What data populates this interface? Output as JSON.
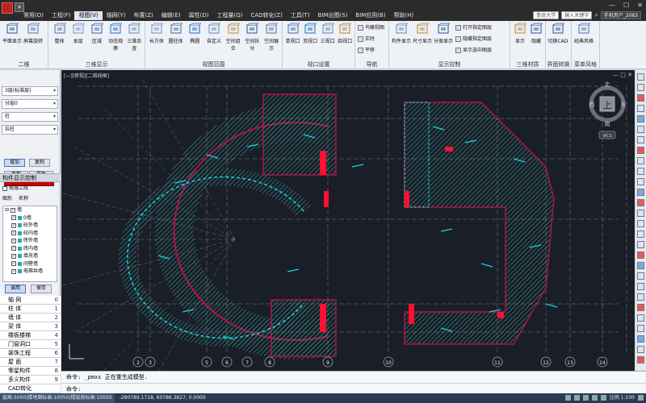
{
  "menu": {
    "quick_access": "▾",
    "items": [
      "常用(O)",
      "工程(F)",
      "视图(V)",
      "轴网(Y)",
      "布置(Z)",
      "编辑(E)",
      "属性(D)",
      "工程量(Q)",
      "CAD转化(Z)",
      "工具(T)",
      "BIM出图(S)",
      "BIM应用(B)",
      "帮助(H)"
    ],
    "active_index": 2,
    "user_company": "鲁班大学",
    "search_placeholder": "输入关键字",
    "user_name": "手机用户_2083",
    "win_min": "—",
    "win_max": "☐",
    "win_close": "✕"
  },
  "ribbon": {
    "groups": [
      {
        "label": "二维",
        "buttons": [
          "平面显示",
          "屏幕旋转"
        ]
      },
      {
        "label": "三维显示",
        "buttons": [
          "整体",
          "本层",
          "区域",
          "动态观察",
          "三维反查"
        ]
      },
      {
        "label": "视图范围",
        "buttons": [
          "长方体",
          "圆柱体",
          "椭圆",
          "自定义",
          "空间组合",
          "空间拆分",
          "空间展示"
        ]
      },
      {
        "label": "视口设置",
        "buttons": [
          "单视口",
          "双视口",
          "三视口",
          "四视口"
        ]
      },
      {
        "label": "导航",
        "small": [
          "鸟瞰视图",
          "实时",
          "平移"
        ]
      },
      {
        "label": "显示控制",
        "buttons": [
          "构件显示",
          "尺寸显示",
          "分类显示"
        ],
        "small": [
          "打开指定图层",
          "隐藏指定图层",
          "显示选中图层"
        ]
      },
      {
        "label": "三维材质",
        "buttons": [
          "显示",
          "隐藏"
        ]
      },
      {
        "label": "界面转换",
        "buttons": [
          "切换CAD"
        ]
      },
      {
        "label": "菜单风格",
        "buttons": [
          "经典风格"
        ]
      }
    ]
  },
  "left_panel": {
    "floor_select": "3层(标准层)",
    "component_group": "分层0",
    "component_type": "柱",
    "component_name": "拉柱",
    "add_button": "增加",
    "copy_button": "复制",
    "param_label": "参数",
    "attr_label": "属性",
    "display_control_title": "构件显示控制",
    "project_checkbox": "按施工段",
    "tab_graph": "图形",
    "tab_name": "名称",
    "tree": [
      {
        "label": "墙",
        "checked": true,
        "indent": 0
      },
      {
        "label": "0墙",
        "checked": true,
        "indent": 1
      },
      {
        "label": "砼外墙",
        "checked": true,
        "indent": 1
      },
      {
        "label": "砼内墙",
        "checked": true,
        "indent": 1
      },
      {
        "label": "砖外墙",
        "checked": true,
        "indent": 1
      },
      {
        "label": "砖内墙",
        "checked": true,
        "indent": 1
      },
      {
        "label": "填充墙",
        "checked": true,
        "indent": 1
      },
      {
        "label": "间壁墙",
        "checked": true,
        "indent": 1
      },
      {
        "label": "电梯井墙",
        "checked": true,
        "indent": 1
      }
    ],
    "apply_button": "调用",
    "save_button": "保存",
    "categories": [
      {
        "name": "轴    网",
        "num": "0"
      },
      {
        "name": "柱    体",
        "num": "1"
      },
      {
        "name": "墙    体",
        "num": "2"
      },
      {
        "name": "梁    体",
        "num": "3"
      },
      {
        "name": "楼板楼梯",
        "num": "4"
      },
      {
        "name": "门窗洞口",
        "num": "5"
      },
      {
        "name": "装饰工程",
        "num": "6"
      },
      {
        "name": "屋    面",
        "num": "7"
      },
      {
        "name": "零星构件",
        "num": "8"
      },
      {
        "name": "多义构件",
        "num": "9"
      },
      {
        "name": "CAD转化",
        "num": ""
      }
    ]
  },
  "viewport": {
    "label": "[—][俯视][二维线框]",
    "ctrl": "— □ ✕",
    "compass": {
      "north": "北",
      "south": "南",
      "east": "东",
      "west": "西",
      "top": "上",
      "wcs": "WCS"
    },
    "axis_labels": [
      "2",
      "3",
      "5",
      "6",
      "7",
      "8",
      "9",
      "10",
      "11",
      "12",
      "13",
      "14"
    ],
    "wall_color": "#b0124a",
    "hatch_color": "#3aa8a0",
    "rebar_color": "#13d6e8",
    "grid_color": "#7a7f8a",
    "accent_red": "#ff1030"
  },
  "command": {
    "line1": "命令: _pmxs 正在重生成模型.",
    "line2": "命令:"
  },
  "status": {
    "floor_info": "层高:5000|楼地面标高:10050|楼层底标高:10050",
    "coords": "-280789.1718, 60786.3827, 0.0000",
    "scale": "比例 1:100"
  }
}
